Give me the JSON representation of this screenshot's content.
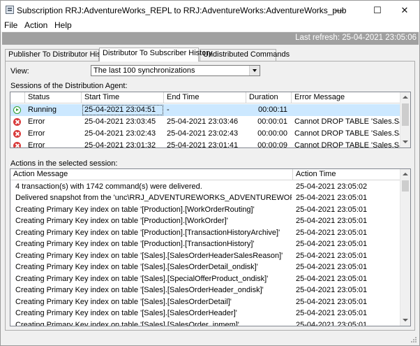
{
  "window": {
    "title": "Subscription RRJ:AdventureWorks_REPL to RRJ:AdventureWorks:AdventureWorks_pub",
    "minimize_glyph": "—",
    "maximize_glyph": "☐",
    "close_glyph": "✕"
  },
  "menu": {
    "file": "File",
    "action": "Action",
    "help": "Help"
  },
  "refresh": {
    "text": "Last refresh: 25-04-2021 23:05:06"
  },
  "tabs": [
    {
      "label": "Publisher To Distributor History",
      "active": false
    },
    {
      "label": "Distributor To Subscriber History",
      "active": true
    },
    {
      "label": "Undistributed Commands",
      "active": false
    }
  ],
  "view": {
    "label": "View:",
    "selected": "The last 100 synchronizations"
  },
  "sessions": {
    "label": "Sessions of the Distribution Agent:",
    "columns": [
      "Status",
      "Start Time",
      "End Time",
      "Duration",
      "Error Message"
    ],
    "rows": [
      {
        "status": "Running",
        "icon": "running-icon",
        "start": "25-04-2021 23:04:51",
        "end": "-",
        "duration": "00:00:11",
        "error": ""
      },
      {
        "status": "Error",
        "icon": "error-icon",
        "start": "25-04-2021 23:03:45",
        "end": "25-04-2021 23:03:46",
        "duration": "00:00:01",
        "error": "Cannot DROP TABLE 'Sales.Sal..."
      },
      {
        "status": "Error",
        "icon": "error-icon",
        "start": "25-04-2021 23:02:43",
        "end": "25-04-2021 23:02:43",
        "duration": "00:00:00",
        "error": "Cannot DROP TABLE 'Sales.Sal..."
      },
      {
        "status": "Error",
        "icon": "error-icon",
        "start": "25-04-2021 23:01:32",
        "end": "25-04-2021 23:01:41",
        "duration": "00:00:09",
        "error": "Cannot DROP TABLE 'Sales.Sal..."
      }
    ]
  },
  "actions": {
    "label": "Actions in the selected session:",
    "columns": [
      "Action Message",
      "Action Time"
    ],
    "rows": [
      {
        "message": "4 transaction(s) with 1742 command(s) were delivered.",
        "time": "25-04-2021 23:05:02"
      },
      {
        "message": "Delivered snapshot from the 'unc\\RRJ_ADVENTUREWORKS_ADVENTUREWORKS_PUB...",
        "time": "25-04-2021 23:05:01"
      },
      {
        "message": "Creating Primary Key index on table '[Production].[WorkOrderRouting]'",
        "time": "25-04-2021 23:05:01"
      },
      {
        "message": "Creating Primary Key index on table '[Production].[WorkOrder]'",
        "time": "25-04-2021 23:05:01"
      },
      {
        "message": "Creating Primary Key index on table '[Production].[TransactionHistoryArchive]'",
        "time": "25-04-2021 23:05:01"
      },
      {
        "message": "Creating Primary Key index on table '[Production].[TransactionHistory]'",
        "time": "25-04-2021 23:05:01"
      },
      {
        "message": "Creating Primary Key index on table '[Sales].[SalesOrderHeaderSalesReason]'",
        "time": "25-04-2021 23:05:01"
      },
      {
        "message": "Creating Primary Key index on table '[Sales].[SalesOrderDetail_ondisk]'",
        "time": "25-04-2021 23:05:01"
      },
      {
        "message": "Creating Primary Key index on table '[Sales].[SpecialOfferProduct_ondisk]'",
        "time": "25-04-2021 23:05:01"
      },
      {
        "message": "Creating Primary Key index on table '[Sales].[SalesOrderHeader_ondisk]'",
        "time": "25-04-2021 23:05:01"
      },
      {
        "message": "Creating Primary Key index on table '[Sales].[SalesOrderDetail]'",
        "time": "25-04-2021 23:05:01"
      },
      {
        "message": "Creating Primary Key index on table '[Sales].[SalesOrderHeader]'",
        "time": "25-04-2021 23:05:01"
      },
      {
        "message": "Creating Primary Key index on table '[Sales].[SalesOrder_inmem]'",
        "time": "25-04-2021 23:05:01"
      }
    ]
  }
}
